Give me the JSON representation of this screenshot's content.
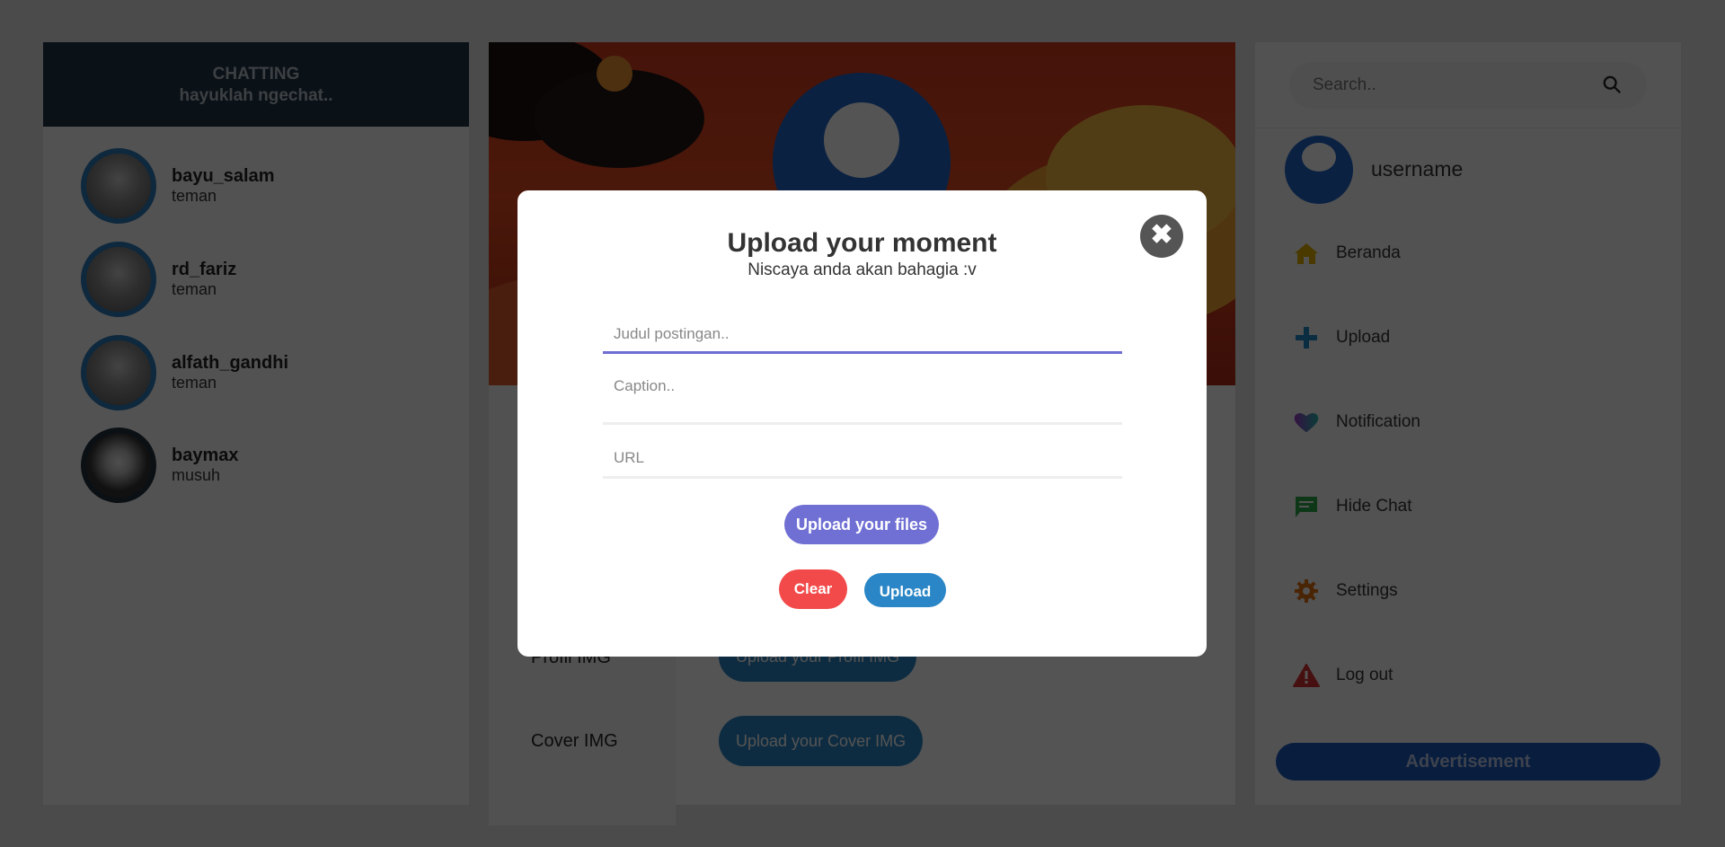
{
  "chat": {
    "title": "CHATTING",
    "subtitle": "hayuklah ngechat..",
    "contacts": [
      {
        "name": "bayu_salam",
        "status": "teman"
      },
      {
        "name": "rd_fariz",
        "status": "teman"
      },
      {
        "name": "alfath_gandhi",
        "status": "teman"
      },
      {
        "name": "baymax",
        "status": "musuh"
      }
    ]
  },
  "profile": {
    "rows": [
      {
        "label": "Profil IMG",
        "button": "Upload your Profil IMG"
      },
      {
        "label": "Cover IMG",
        "button": "Upload your Cover IMG"
      }
    ]
  },
  "sidebar": {
    "search_placeholder": "Search..",
    "username": "username",
    "items": [
      {
        "label": "Beranda",
        "icon": "home-icon",
        "color": "#e0b000"
      },
      {
        "label": "Upload",
        "icon": "plus-icon",
        "color": "#1e88c8"
      },
      {
        "label": "Notification",
        "icon": "heart-icon",
        "color": "#8a3cc8"
      },
      {
        "label": "Hide Chat",
        "icon": "chat-icon",
        "color": "#2aa84a"
      },
      {
        "label": "Settings",
        "icon": "gear-icon",
        "color": "#e07010"
      },
      {
        "label": "Log out",
        "icon": "warning-icon",
        "color": "#d83030"
      }
    ],
    "advertisement": "Advertisement"
  },
  "modal": {
    "title": "Upload your moment",
    "subtitle": "Niscaya anda akan bahagia :v",
    "title_placeholder": "Judul postingan..",
    "caption_placeholder": "Caption..",
    "url_placeholder": "URL",
    "upload_files_label": "Upload your files",
    "clear_label": "Clear",
    "upload_label": "Upload",
    "close_glyph": "✖",
    "colors": {
      "upload_files": "#7070d4",
      "clear": "#f24a4a",
      "upload": "#2a86c6"
    }
  }
}
